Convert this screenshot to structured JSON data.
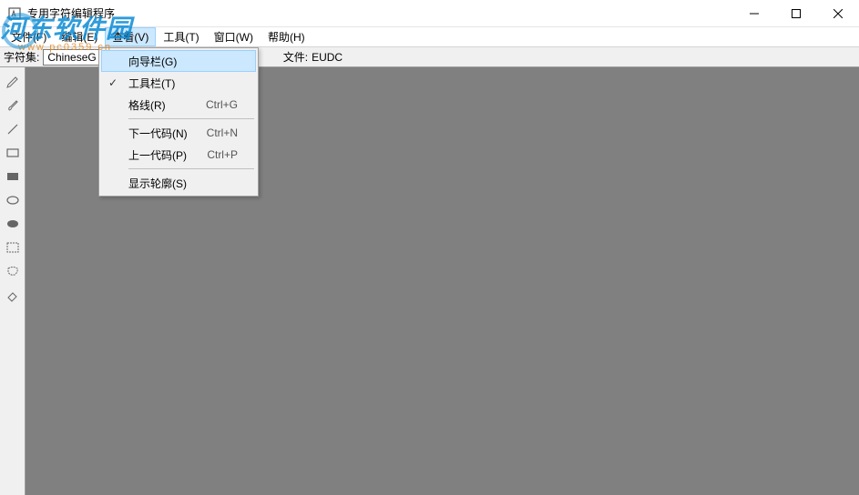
{
  "window": {
    "title": "专用字符编辑程序"
  },
  "menubar": {
    "items": [
      {
        "label": "文件(F)"
      },
      {
        "label": "编辑(E)"
      },
      {
        "label": "查看(V)"
      },
      {
        "label": "工具(T)"
      },
      {
        "label": "窗口(W)"
      },
      {
        "label": "帮助(H)"
      }
    ]
  },
  "infobar": {
    "charset_label": "字符集:",
    "charset_value": "ChineseG",
    "file_label": "文件:",
    "file_value": "EUDC"
  },
  "dropdown": {
    "items": [
      {
        "label": "向导栏(G)",
        "checked": false,
        "shortcut": "",
        "highlight": true
      },
      {
        "label": "工具栏(T)",
        "checked": true,
        "shortcut": ""
      },
      {
        "label": "格线(R)",
        "checked": false,
        "shortcut": "Ctrl+G"
      },
      {
        "sep": true
      },
      {
        "label": "下一代码(N)",
        "checked": false,
        "shortcut": "Ctrl+N"
      },
      {
        "label": "上一代码(P)",
        "checked": false,
        "shortcut": "Ctrl+P"
      },
      {
        "sep": true
      },
      {
        "label": "显示轮廓(S)",
        "checked": false,
        "shortcut": ""
      }
    ]
  },
  "watermark": {
    "text": "河东软件园",
    "sub": "www.pc0359.cn"
  }
}
